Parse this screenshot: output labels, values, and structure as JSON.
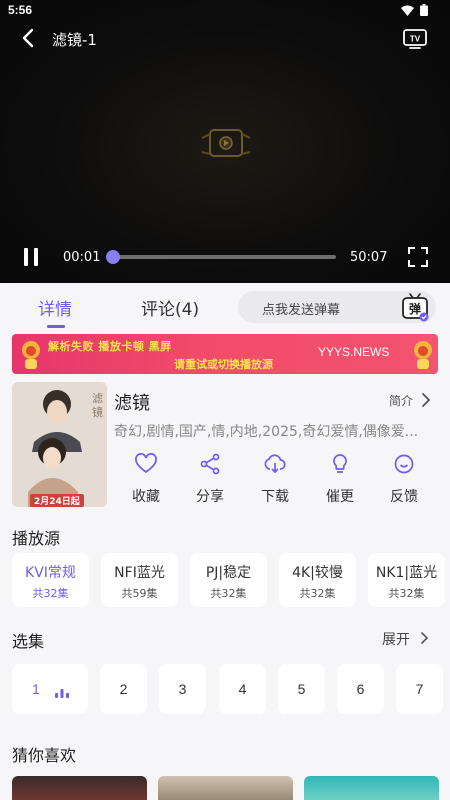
{
  "status_bar": {
    "time": "5:56"
  },
  "player": {
    "title": "滤镜-1",
    "current_time": "00:01",
    "duration": "50:07",
    "progress": 0.0
  },
  "tabs": [
    {
      "label": "详情",
      "active": true
    },
    {
      "label": "评论(4)",
      "active": false
    }
  ],
  "danmaku": {
    "placeholder": "点我发送弹幕",
    "icon_text": "弹"
  },
  "banner": {
    "line1": "解析失败  播放卡顿  黑屏",
    "line2": "请重试或切换播放源",
    "site": "YYYS.NEWS"
  },
  "show": {
    "title": "滤镜",
    "intro_label": "简介",
    "tags": "奇幻,剧情,国产,情,内地,2025,奇幻爱情,偶像爱...",
    "poster_date": "2月24日起"
  },
  "actions": [
    {
      "label": "收藏",
      "icon": "heart-icon"
    },
    {
      "label": "分享",
      "icon": "share-icon"
    },
    {
      "label": "下载",
      "icon": "download-icon"
    },
    {
      "label": "催更",
      "icon": "bulb-icon"
    },
    {
      "label": "反馈",
      "icon": "feedback-icon"
    }
  ],
  "sources_title": "播放源",
  "sources": [
    {
      "name": "KVI常规",
      "count": "共32集",
      "active": true
    },
    {
      "name": "NFI蓝光",
      "count": "共59集",
      "active": false
    },
    {
      "name": "PJ|稳定",
      "count": "共32集",
      "active": false
    },
    {
      "name": "4K|较慢",
      "count": "共32集",
      "active": false
    },
    {
      "name": "NK1|蓝光",
      "count": "共32集",
      "active": false
    }
  ],
  "episodes_title": "选集",
  "expand_label": "展开",
  "episodes": [
    "1",
    "2",
    "3",
    "4",
    "5",
    "6",
    "7"
  ],
  "recommend_title": "猜你喜欢",
  "colors": {
    "accent": "#6f5cf0",
    "banner": "#ef4468",
    "banner_text": "#ffe64a"
  }
}
